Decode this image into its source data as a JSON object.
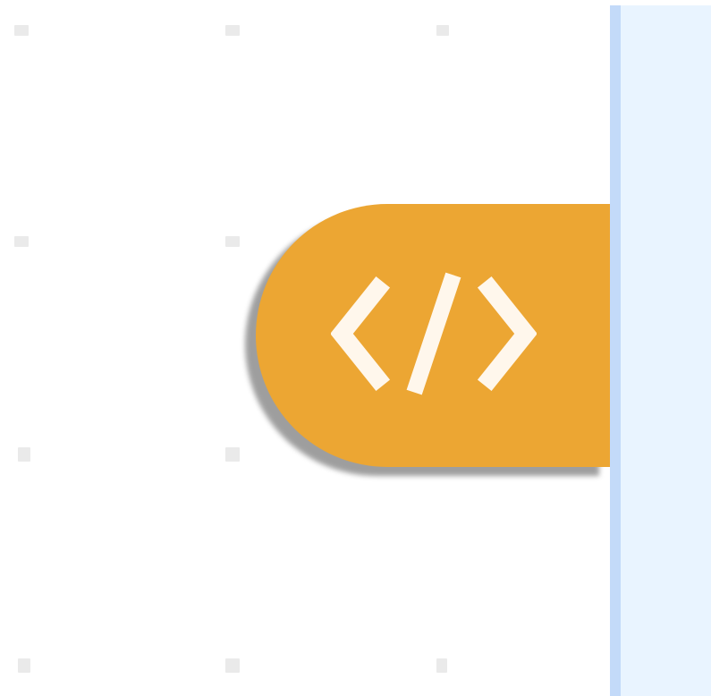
{
  "workspace": {
    "block": {
      "icon": "code-icon",
      "label": "",
      "color": "#eca633"
    }
  },
  "side_panel": {
    "color": "#e9f4ff",
    "divider_color": "#c3daf9"
  }
}
